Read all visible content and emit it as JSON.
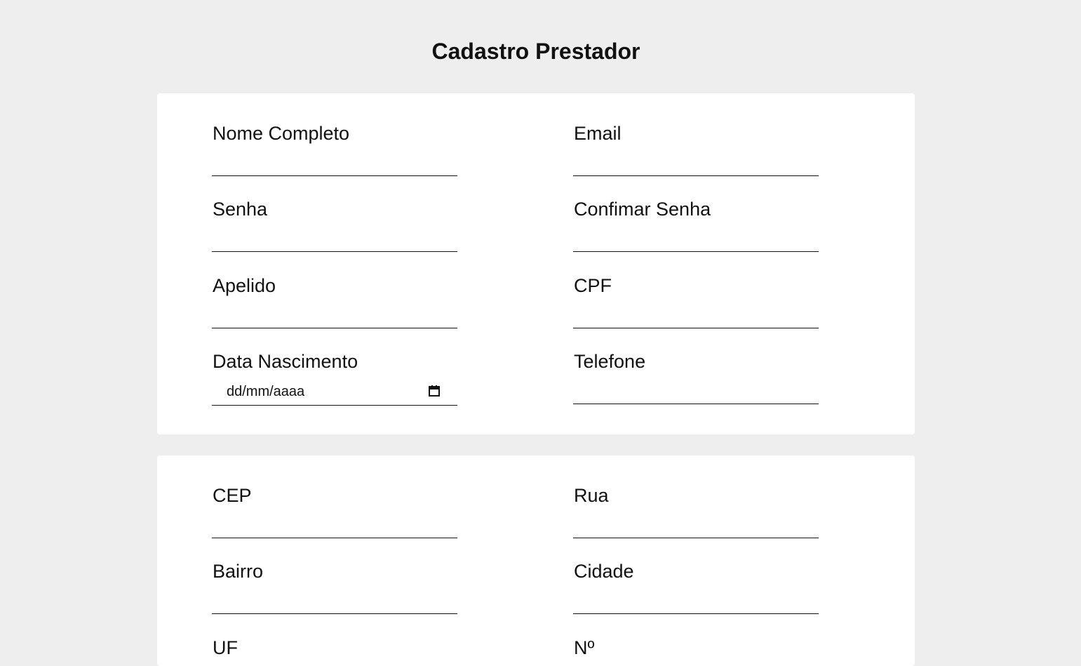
{
  "page": {
    "title": "Cadastro Prestador"
  },
  "personal": {
    "nome_completo": {
      "label": "Nome Completo",
      "value": ""
    },
    "email": {
      "label": "Email",
      "value": ""
    },
    "senha": {
      "label": "Senha",
      "value": ""
    },
    "confirmar_senha": {
      "label": "Confimar Senha",
      "value": ""
    },
    "apelido": {
      "label": "Apelido",
      "value": ""
    },
    "cpf": {
      "label": "CPF",
      "value": ""
    },
    "data_nascimento": {
      "label": "Data Nascimento",
      "placeholder": "dd/mm/aaaa",
      "icon": "calendar-icon"
    },
    "telefone": {
      "label": "Telefone",
      "value": ""
    }
  },
  "address": {
    "cep": {
      "label": "CEP",
      "value": ""
    },
    "rua": {
      "label": "Rua",
      "value": ""
    },
    "bairro": {
      "label": "Bairro",
      "value": ""
    },
    "cidade": {
      "label": "Cidade",
      "value": ""
    },
    "uf": {
      "label": "UF"
    },
    "numero": {
      "label": "Nº"
    }
  },
  "colors": {
    "background": "#eeeeee",
    "card": "#ffffff",
    "text": "#111111"
  }
}
